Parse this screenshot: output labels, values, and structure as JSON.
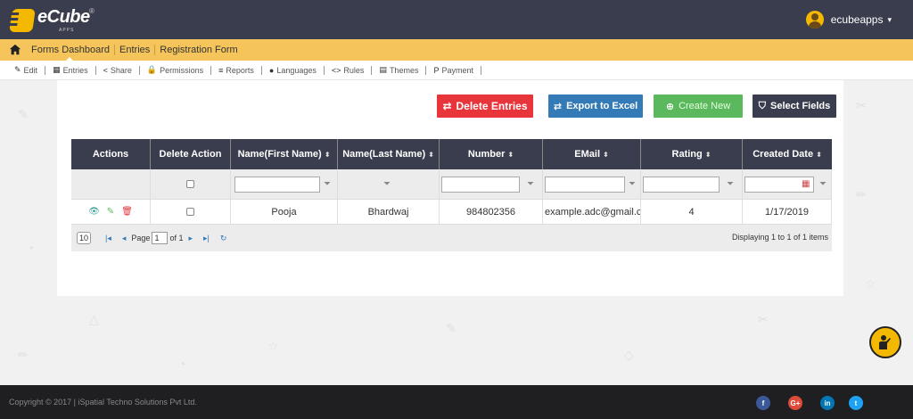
{
  "header": {
    "logo_text": "eCube",
    "logo_sub": "APPS",
    "logo_reg": "®",
    "username": "ecubeapps"
  },
  "breadcrumb": {
    "items": [
      "Forms Dashboard",
      "Entries",
      "Registration Form"
    ]
  },
  "toolbar": {
    "items": [
      {
        "icon": "✎",
        "label": "Edit"
      },
      {
        "icon": "▦",
        "label": "Entries"
      },
      {
        "icon": "<",
        "label": "Share"
      },
      {
        "icon": "🔒",
        "label": "Permissions"
      },
      {
        "icon": "≡",
        "label": "Reports"
      },
      {
        "icon": "●",
        "label": "Languages"
      },
      {
        "icon": "<>",
        "label": "Rules"
      },
      {
        "icon": "▤",
        "label": "Themes"
      },
      {
        "icon": "P",
        "label": "Payment"
      }
    ]
  },
  "actions": {
    "delete_label": "Delete Entries",
    "export_label": "Export to Excel",
    "create_label": "Create New",
    "select_label": "Select Fields"
  },
  "table": {
    "columns": [
      "Actions",
      "Delete Action",
      "Name(First Name)",
      "Name(Last Name)",
      "Number",
      "EMail",
      "Rating",
      "Created Date"
    ],
    "rows": [
      {
        "first_name": "Pooja",
        "last_name": "Bhardwaj",
        "number": "984802356",
        "email": "example.adc@gmail.com",
        "rating": "4",
        "created": "1/17/2019"
      }
    ]
  },
  "pager": {
    "page_size": "10",
    "page_label": "Page",
    "page_value": "1",
    "of_label": "of 1",
    "info": "Displaying 1 to 1 of 1 items"
  },
  "footer": {
    "copyright": "Copyright © 2017 | iSpatial Techno Solutions Pvt Ltd."
  },
  "colors": {
    "header_bg": "#3a3d4d",
    "breadcrumb_bg": "#f5c55b",
    "delete": "#e8353b",
    "export": "#337ab7",
    "create": "#5cb85c"
  }
}
